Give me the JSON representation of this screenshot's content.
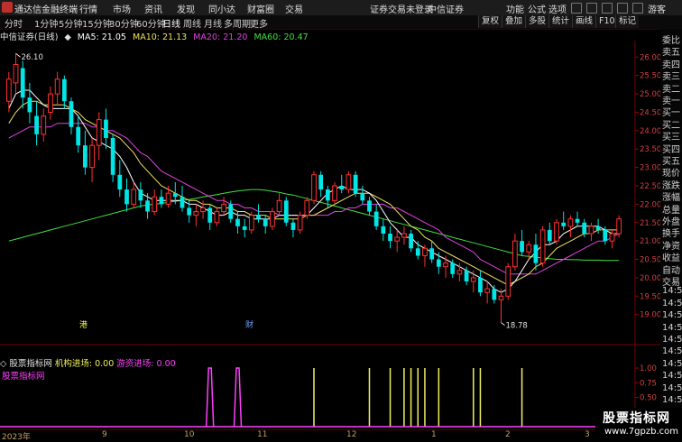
{
  "titlebar": {
    "app_name": "通达信金融终端",
    "menu": [
      "行情",
      "市场",
      "资讯",
      "发现",
      "同小达",
      "财富圈",
      "交易"
    ],
    "notice": "证券交易未登录",
    "broker": "中信证券",
    "right_menu": [
      "功能",
      "公式",
      "选项"
    ],
    "guest": "游客"
  },
  "periods": [
    "分时",
    "1分钟",
    "5分钟",
    "15分钟",
    "30分钟",
    "60分钟",
    "日线",
    "周线",
    "月线",
    "多周期",
    "更多"
  ],
  "active_period": "日线",
  "toolbar_right": [
    "复权",
    "叠加",
    "多股",
    "统计",
    "画线",
    "F10",
    "标记"
  ],
  "stock": {
    "name_period": "中信证券(日线)",
    "ma": [
      {
        "label": "MA5: 21.05",
        "color": "#ffffff"
      },
      {
        "label": "MA10: 21.13",
        "color": "#f0e060"
      },
      {
        "label": "MA20: 21.20",
        "color": "#e040e0"
      },
      {
        "label": "MA60: 20.47",
        "color": "#40e040"
      }
    ]
  },
  "price_axis": [
    "26.00",
    "25.50",
    "25.00",
    "24.50",
    "24.00",
    "23.50",
    "23.00",
    "22.50",
    "22.00",
    "21.50",
    "21.00",
    "20.50",
    "20.00",
    "19.50",
    "19.00"
  ],
  "annotations": {
    "high": "26.10",
    "low": "18.78"
  },
  "markers": {
    "gang": "港",
    "cai": "财"
  },
  "side_panel": [
    "委比",
    "卖五",
    "卖四",
    "卖三",
    "卖二",
    "卖一",
    "买一",
    "买二",
    "买三",
    "买四",
    "买五",
    "现价",
    "涨跌",
    "涨幅",
    "总量",
    "外盘",
    "换手",
    "净资",
    "收益",
    "自动",
    "交易",
    "14:5",
    "14:5",
    "14:5",
    "14:5",
    "14:5",
    "14:5",
    "14:5",
    "14:5",
    "14:5",
    "14:5",
    "14:5",
    "14:5"
  ],
  "indicator": {
    "name": "股票指标网",
    "jigou_label": "机构进场: 0.00",
    "youzi_label": "游资进场: 0.00",
    "subtitle": "股票指标网",
    "axis": [
      "1.00",
      "0.75",
      "0.50",
      "0.25",
      "0.00"
    ]
  },
  "dates": {
    "year": "2023年",
    "months": [
      "9",
      "10",
      "11",
      "12",
      "1",
      "2",
      "3"
    ]
  },
  "watermark": {
    "title": "股票指标网",
    "url": "www.7gpzb.com"
  },
  "colors": {
    "up": "#ff3030",
    "down": "#00e5e5",
    "ma5": "#ffffff",
    "ma10": "#f0e060",
    "ma20": "#e040e0",
    "ma60": "#40e040",
    "youzi": "#ff40ff",
    "jigou": "#f0f060"
  },
  "chart_data": {
    "type": "candlestick",
    "y_range": [
      18.6,
      26.4
    ],
    "ohlc": [
      [
        24.8,
        25.6,
        24.5,
        25.4
      ],
      [
        25.3,
        26.1,
        25.0,
        25.8
      ],
      [
        25.7,
        25.9,
        24.6,
        24.9
      ],
      [
        24.9,
        25.3,
        24.2,
        24.5
      ],
      [
        24.4,
        24.8,
        23.6,
        23.9
      ],
      [
        23.9,
        24.6,
        23.7,
        24.4
      ],
      [
        24.5,
        25.2,
        24.3,
        25.0
      ],
      [
        25.0,
        25.6,
        24.7,
        25.4
      ],
      [
        25.4,
        25.5,
        24.6,
        24.8
      ],
      [
        24.8,
        24.9,
        23.9,
        24.1
      ],
      [
        24.1,
        24.4,
        23.4,
        23.6
      ],
      [
        23.6,
        24.0,
        22.8,
        23.0
      ],
      [
        23.0,
        23.8,
        22.6,
        23.6
      ],
      [
        23.6,
        24.5,
        23.2,
        24.3
      ],
      [
        24.3,
        24.6,
        23.5,
        23.8
      ],
      [
        23.8,
        23.9,
        22.6,
        22.8
      ],
      [
        22.8,
        23.2,
        22.2,
        22.4
      ],
      [
        22.4,
        22.7,
        21.8,
        22.0
      ],
      [
        22.0,
        22.6,
        21.9,
        22.4
      ],
      [
        22.4,
        22.6,
        21.9,
        22.1
      ],
      [
        22.1,
        22.3,
        21.6,
        21.8
      ],
      [
        21.8,
        22.4,
        21.7,
        22.2
      ],
      [
        22.2,
        22.4,
        21.9,
        22.0
      ],
      [
        22.0,
        22.5,
        21.9,
        22.3
      ],
      [
        22.3,
        22.6,
        22.0,
        22.2
      ],
      [
        22.2,
        22.5,
        21.8,
        21.9
      ],
      [
        21.9,
        22.1,
        21.5,
        21.7
      ],
      [
        21.7,
        22.0,
        21.4,
        21.8
      ],
      [
        21.8,
        22.1,
        21.6,
        21.9
      ],
      [
        21.9,
        22.0,
        21.3,
        21.5
      ],
      [
        21.5,
        21.9,
        21.4,
        21.8
      ],
      [
        21.8,
        22.2,
        21.7,
        22.0
      ],
      [
        22.0,
        22.1,
        21.5,
        21.6
      ],
      [
        21.6,
        21.8,
        21.2,
        21.4
      ],
      [
        21.4,
        21.6,
        21.1,
        21.3
      ],
      [
        21.3,
        21.8,
        21.2,
        21.7
      ],
      [
        21.7,
        22.0,
        21.5,
        21.6
      ],
      [
        21.6,
        21.7,
        21.2,
        21.4
      ],
      [
        21.4,
        21.9,
        21.3,
        21.8
      ],
      [
        21.8,
        22.3,
        21.7,
        22.1
      ],
      [
        22.1,
        22.2,
        21.4,
        21.5
      ],
      [
        21.5,
        21.6,
        21.1,
        21.3
      ],
      [
        21.3,
        21.8,
        21.2,
        21.7
      ],
      [
        21.7,
        22.2,
        21.6,
        22.1
      ],
      [
        22.1,
        22.9,
        22.0,
        22.8
      ],
      [
        22.8,
        22.9,
        22.2,
        22.4
      ],
      [
        22.4,
        22.5,
        21.9,
        22.1
      ],
      [
        22.1,
        22.6,
        22.0,
        22.5
      ],
      [
        22.5,
        22.8,
        22.3,
        22.4
      ],
      [
        22.4,
        22.9,
        22.3,
        22.8
      ],
      [
        22.8,
        22.9,
        22.2,
        22.3
      ],
      [
        22.3,
        22.5,
        22.0,
        22.1
      ],
      [
        22.1,
        22.2,
        21.7,
        21.8
      ],
      [
        21.8,
        22.0,
        21.3,
        21.4
      ],
      [
        21.4,
        21.6,
        21.0,
        21.2
      ],
      [
        21.2,
        21.4,
        20.8,
        21.0
      ],
      [
        21.0,
        21.3,
        20.7,
        21.1
      ],
      [
        21.1,
        21.4,
        20.9,
        21.2
      ],
      [
        21.2,
        21.3,
        20.7,
        20.8
      ],
      [
        20.8,
        21.0,
        20.5,
        20.6
      ],
      [
        20.6,
        20.9,
        20.3,
        20.8
      ],
      [
        20.8,
        21.0,
        20.4,
        20.5
      ],
      [
        20.5,
        20.7,
        20.1,
        20.3
      ],
      [
        20.3,
        20.6,
        20.0,
        20.4
      ],
      [
        20.4,
        20.5,
        20.0,
        20.1
      ],
      [
        20.1,
        20.4,
        19.9,
        20.2
      ],
      [
        20.2,
        20.3,
        19.8,
        19.9
      ],
      [
        19.9,
        20.2,
        19.6,
        20.0
      ],
      [
        20.0,
        20.2,
        19.5,
        19.6
      ],
      [
        19.6,
        19.9,
        19.3,
        19.7
      ],
      [
        19.7,
        19.8,
        19.3,
        19.4
      ],
      [
        19.4,
        19.7,
        18.78,
        19.5
      ],
      [
        19.5,
        20.4,
        19.4,
        20.3
      ],
      [
        20.3,
        21.2,
        20.2,
        21.0
      ],
      [
        21.0,
        21.3,
        20.6,
        20.7
      ],
      [
        20.7,
        21.0,
        20.5,
        20.9
      ],
      [
        20.9,
        21.2,
        20.2,
        20.4
      ],
      [
        20.4,
        21.4,
        20.3,
        21.3
      ],
      [
        21.3,
        21.5,
        20.9,
        21.0
      ],
      [
        21.0,
        21.6,
        20.9,
        21.5
      ],
      [
        21.5,
        21.8,
        21.3,
        21.4
      ],
      [
        21.4,
        21.7,
        21.1,
        21.6
      ],
      [
        21.6,
        21.8,
        21.4,
        21.5
      ],
      [
        21.5,
        21.6,
        21.1,
        21.2
      ],
      [
        21.2,
        21.5,
        21.0,
        21.4
      ],
      [
        21.4,
        21.6,
        21.2,
        21.3
      ],
      [
        21.3,
        21.4,
        20.9,
        21.0
      ],
      [
        21.0,
        21.3,
        20.8,
        21.2
      ],
      [
        21.2,
        21.7,
        21.1,
        21.6
      ]
    ],
    "ma5": [
      24.6,
      25.0,
      25.1,
      25.1,
      24.9,
      24.7,
      24.6,
      24.6,
      24.6,
      24.6,
      24.4,
      24.1,
      23.8,
      23.7,
      23.6,
      23.5,
      23.3,
      23.0,
      22.6,
      22.3,
      22.2,
      22.1,
      22.1,
      22.1,
      22.1,
      22.1,
      22.0,
      22.0,
      21.9,
      21.8,
      21.7,
      21.7,
      21.8,
      21.7,
      21.7,
      21.6,
      21.6,
      21.6,
      21.6,
      21.7,
      21.7,
      21.7,
      21.7,
      21.7,
      21.9,
      22.1,
      22.3,
      22.4,
      22.5,
      22.4,
      22.4,
      22.4,
      22.3,
      22.1,
      21.8,
      21.5,
      21.3,
      21.1,
      21.1,
      20.9,
      20.8,
      20.7,
      20.6,
      20.5,
      20.4,
      20.3,
      20.2,
      20.1,
      20.0,
      19.9,
      19.7,
      19.6,
      19.7,
      19.9,
      20.2,
      20.5,
      20.7,
      20.9,
      20.9,
      21.0,
      21.2,
      21.3,
      21.4,
      21.4,
      21.4,
      21.4,
      21.3,
      21.2,
      21.2
    ],
    "ma10": [
      24.2,
      24.5,
      24.7,
      24.8,
      24.8,
      24.7,
      24.7,
      24.7,
      24.7,
      24.6,
      24.5,
      24.3,
      24.2,
      24.1,
      24.0,
      23.9,
      23.8,
      23.6,
      23.4,
      23.1,
      22.9,
      22.7,
      22.5,
      22.4,
      22.3,
      22.2,
      22.1,
      22.1,
      22.0,
      22.0,
      21.9,
      21.9,
      21.9,
      21.8,
      21.8,
      21.7,
      21.7,
      21.7,
      21.6,
      21.6,
      21.6,
      21.6,
      21.6,
      21.7,
      21.7,
      21.8,
      21.9,
      22.0,
      22.1,
      22.2,
      22.3,
      22.3,
      22.3,
      22.2,
      22.1,
      22.0,
      21.8,
      21.6,
      21.4,
      21.3,
      21.1,
      21.0,
      20.8,
      20.7,
      20.6,
      20.5,
      20.4,
      20.3,
      20.2,
      20.1,
      20.0,
      19.9,
      19.8,
      19.9,
      20.0,
      20.1,
      20.3,
      20.4,
      20.6,
      20.8,
      20.9,
      21.0,
      21.1,
      21.2,
      21.2,
      21.3,
      21.3,
      21.3,
      21.3
    ],
    "ma20": [
      23.8,
      23.9,
      24.0,
      24.1,
      24.1,
      24.1,
      24.1,
      24.2,
      24.2,
      24.2,
      24.2,
      24.2,
      24.1,
      24.1,
      24.0,
      24.0,
      23.9,
      23.8,
      23.6,
      23.4,
      23.3,
      23.1,
      22.9,
      22.8,
      22.7,
      22.6,
      22.5,
      22.4,
      22.3,
      22.2,
      22.1,
      22.1,
      22.0,
      22.0,
      21.9,
      21.9,
      21.8,
      21.8,
      21.8,
      21.7,
      21.7,
      21.7,
      21.7,
      21.7,
      21.7,
      21.7,
      21.7,
      21.8,
      21.8,
      21.9,
      21.9,
      22.0,
      22.0,
      22.0,
      22.0,
      21.9,
      21.9,
      21.8,
      21.7,
      21.6,
      21.5,
      21.4,
      21.3,
      21.1,
      21.0,
      20.9,
      20.8,
      20.7,
      20.5,
      20.4,
      20.3,
      20.2,
      20.1,
      20.1,
      20.1,
      20.1,
      20.1,
      20.2,
      20.3,
      20.4,
      20.5,
      20.6,
      20.7,
      20.8,
      20.9,
      21.0,
      21.0,
      21.1,
      21.2
    ],
    "ma60": [
      21.0,
      21.05,
      21.1,
      21.15,
      21.2,
      21.25,
      21.3,
      21.35,
      21.4,
      21.45,
      21.5,
      21.55,
      21.6,
      21.65,
      21.7,
      21.75,
      21.8,
      21.85,
      21.9,
      21.95,
      21.98,
      22.0,
      22.02,
      22.05,
      22.08,
      22.1,
      22.13,
      22.16,
      22.2,
      22.23,
      22.26,
      22.3,
      22.33,
      22.36,
      22.38,
      22.4,
      22.4,
      22.38,
      22.35,
      22.32,
      22.28,
      22.25,
      22.2,
      22.15,
      22.1,
      22.05,
      22.0,
      21.95,
      21.9,
      21.85,
      21.8,
      21.75,
      21.7,
      21.65,
      21.6,
      21.55,
      21.5,
      21.45,
      21.4,
      21.35,
      21.3,
      21.25,
      21.2,
      21.15,
      21.1,
      21.05,
      21.0,
      20.95,
      20.9,
      20.85,
      20.8,
      20.75,
      20.7,
      20.65,
      20.6,
      20.58,
      20.56,
      20.54,
      20.52,
      20.5,
      20.5,
      20.49,
      20.49,
      20.48,
      20.48,
      20.48,
      20.47,
      20.47,
      20.47
    ],
    "indicator_pulses": {
      "youzi_index": [
        29,
        33
      ],
      "jigou_index": [
        44,
        52,
        55,
        57,
        58,
        59,
        60,
        62,
        67,
        68,
        74
      ]
    }
  }
}
